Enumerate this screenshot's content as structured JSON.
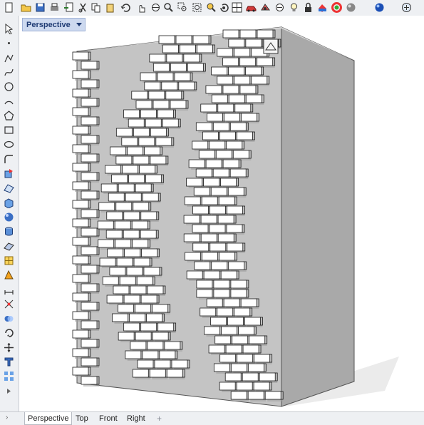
{
  "viewport": {
    "title": "Perspective"
  },
  "tabs": [
    "Perspective",
    "Top",
    "Front",
    "Right"
  ],
  "add_tab_symbol": "+",
  "top_toolbar_icons": [
    "new-file-icon",
    "open-folder-icon",
    "save-icon",
    "print-icon",
    "import-icon",
    "cut-icon",
    "copy-icon",
    "paste-icon",
    "undo-icon",
    "pan-hand-icon",
    "rotate-view-icon",
    "zoom-icon",
    "zoom-window-icon",
    "zoom-extents-icon",
    "zoom-selected-icon",
    "undo-view-icon",
    "four-viewports-icon",
    "car-icon",
    "render-icon",
    "hide-icon",
    "lightbulb-icon",
    "lock-icon",
    "material-icon",
    "color-wheel-icon",
    "shaded-sphere-icon",
    "render-sphere-icon",
    "more-icon"
  ],
  "left_toolbar_icons": [
    "select-arrow-icon",
    "point-icon",
    "polyline-icon",
    "curve-icon",
    "circle-icon",
    "arc-icon",
    "polygon-icon",
    "rectangle-icon",
    "ellipse-icon",
    "fillet-icon",
    "transform-icon",
    "surface-icon",
    "box-icon",
    "sphere-icon",
    "extrude-icon",
    "plane-icon",
    "mesh-icon",
    "analyze-icon",
    "dimension-icon",
    "snap-icon",
    "boolean-icon",
    "rotate-icon",
    "move-icon",
    "text-icon",
    "array-icon",
    "more-arrow-icon"
  ],
  "colors": {
    "toolbar_bg": "#eef0f3",
    "viewport_title_bg": "#cdd9ef",
    "front_face": "#c4c4c4",
    "right_face": "#a9a9a9",
    "top_face": "#d8d8d8",
    "brick": "#ffffff",
    "brick_side": "#bdbdbd",
    "brick_outline": "#1a1a1a"
  },
  "model": {
    "description_hidden": true,
    "brick_column_count": 3
  }
}
